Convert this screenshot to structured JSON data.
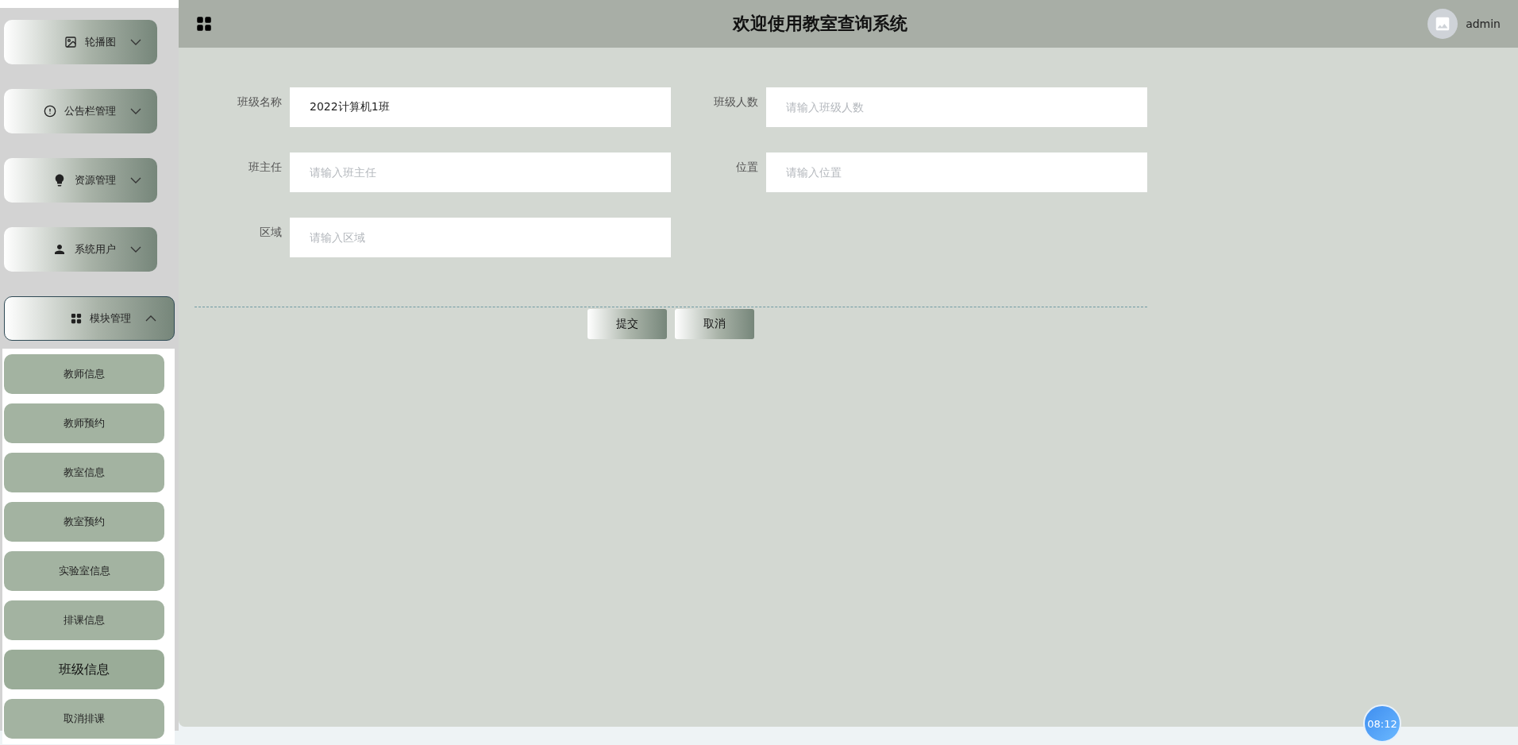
{
  "sidebar": {
    "menus": [
      {
        "label": "轮播图",
        "expanded": false
      },
      {
        "label": "公告栏管理",
        "expanded": false
      },
      {
        "label": "资源管理",
        "expanded": false
      },
      {
        "label": "系统用户",
        "expanded": false
      },
      {
        "label": "模块管理",
        "expanded": true,
        "children": [
          {
            "label": "教师信息",
            "selected": false
          },
          {
            "label": "教师预约",
            "selected": false
          },
          {
            "label": "教室信息",
            "selected": false
          },
          {
            "label": "教室预约",
            "selected": false
          },
          {
            "label": "实验室信息",
            "selected": false
          },
          {
            "label": "排课信息",
            "selected": false
          },
          {
            "label": "班级信息",
            "selected": true
          },
          {
            "label": "取消排课",
            "selected": false
          }
        ]
      }
    ]
  },
  "header": {
    "title": "欢迎使用教室查询系统",
    "user": "admin"
  },
  "form": {
    "fields": [
      {
        "label": "班级名称",
        "value": "2022计算机1班"
      },
      {
        "label": "班级人数",
        "placeholder": "请输入班级人数"
      },
      {
        "label": "班主任",
        "placeholder": "请输入班主任"
      },
      {
        "label": "位置",
        "placeholder": "请输入位置"
      },
      {
        "label": "区域",
        "placeholder": "请输入区域"
      }
    ],
    "buttons": [
      "提交",
      "取消"
    ]
  },
  "clock_badge": "08:12"
}
